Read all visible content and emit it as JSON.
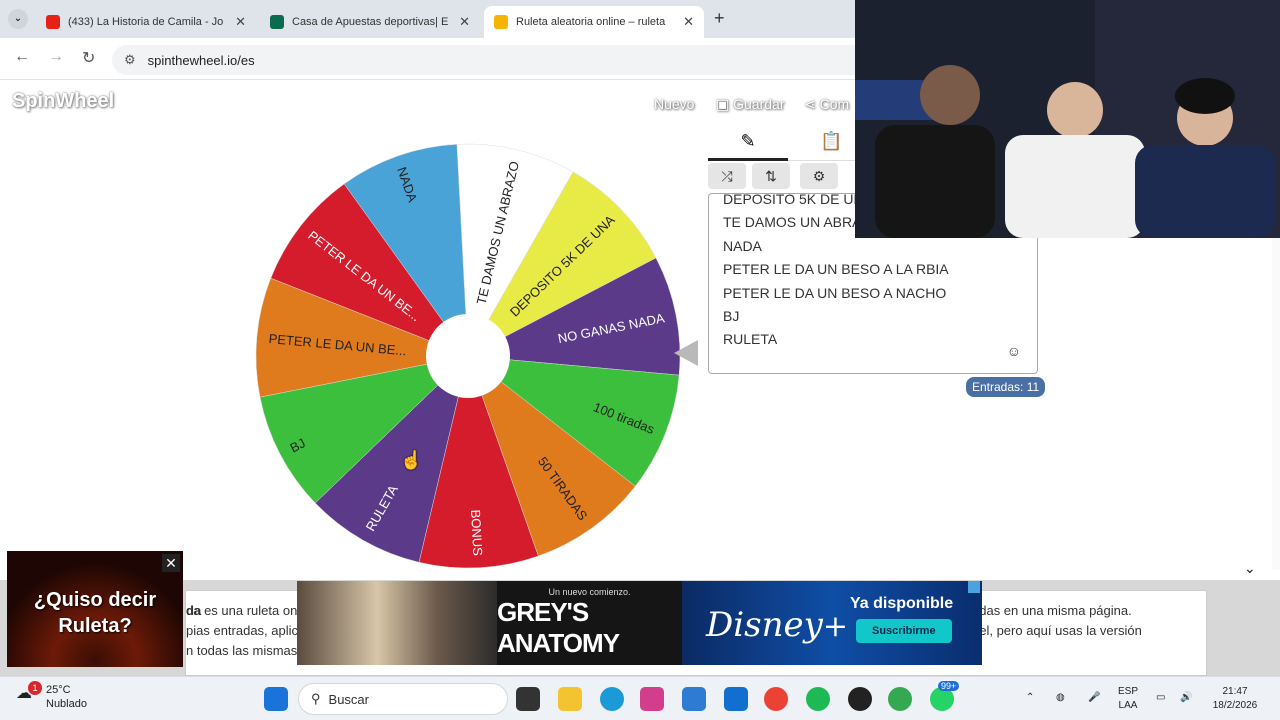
{
  "browser": {
    "tabs": [
      {
        "title": "(433) La Historia de Camila - Jo",
        "favicon_color": "#e62117",
        "active": false
      },
      {
        "title": "Casa de Apuestas deportivas| E",
        "favicon_color": "#0b6b4f",
        "active": false
      },
      {
        "title": "Ruleta aleatoria online – ruleta",
        "favicon_color": "#f4b400",
        "active": true
      }
    ],
    "url": "spinthewheel.io/es"
  },
  "site": {
    "logo": "SpinWheel",
    "nav": {
      "new": "Nuevo",
      "save": "Guardar",
      "share": "Com"
    },
    "wheel_segments": [
      {
        "label": "TE DAMOS UN ABRAZO",
        "color": "#ffffff",
        "text_color": "#222222"
      },
      {
        "label": "DEPOSITO 5K DE UNA",
        "color": "#e8ea45",
        "text_color": "#222222"
      },
      {
        "label": "NO GANAS NADA",
        "color": "#5c3a8a",
        "text_color": "#ffffff"
      },
      {
        "label": "100 tiradas",
        "color": "#3cbf3c",
        "text_color": "#222222"
      },
      {
        "label": "50 TIRADAS",
        "color": "#e07b1d",
        "text_color": "#222222"
      },
      {
        "label": "BONUS",
        "color": "#d41c2c",
        "text_color": "#ffffff"
      },
      {
        "label": "RULETA",
        "color": "#5c3a8a",
        "text_color": "#ffffff"
      },
      {
        "label": "BJ",
        "color": "#3cbf3c",
        "text_color": "#222222"
      },
      {
        "label": "PETER LE DA UN BE...",
        "color": "#e07b1d",
        "text_color": "#222222"
      },
      {
        "label": "PETER LE DA UN BE...",
        "color": "#d41c2c",
        "text_color": "#ffffff"
      },
      {
        "label": "NADA",
        "color": "#4aa3d6",
        "text_color": "#222222"
      }
    ],
    "panel": {
      "entries": [
        "DEPOSITO 5K DE UN",
        "TE DAMOS UN ABRA",
        "NADA",
        "PETER LE DA UN BESO A LA RBIA",
        "PETER LE DA UN BESO A NACHO",
        "BJ",
        "RULETA"
      ],
      "count_label": "Entradas: 11"
    },
    "description": {
      "left_lines": [
        "da es una ruleta onli",
        "pias entradas, aplic",
        "n todas las mismas"
      ],
      "right_lines": [
        "adas en una misma página.",
        "eel, pero aquí usas la versión"
      ],
      "bold_prefix": "da"
    }
  },
  "ads": {
    "popup_text": "¿Quiso decir Ruleta?",
    "banner_show": "GREY'S ANATOMY",
    "banner_tagline": "Un nuevo comienzo.",
    "banner_brand": "Disney",
    "banner_plus": "+",
    "banner_available": "Ya disponible",
    "banner_cta": "Suscribirme"
  },
  "taskbar": {
    "weather_temp": "25°C",
    "weather_desc": "Nublado",
    "weather_badge": "1",
    "search_placeholder": "Buscar",
    "lang1": "ESP",
    "lang2": "LAA",
    "time": "21:47",
    "date": "18/2/2026",
    "whatsapp_badge": "99+"
  }
}
